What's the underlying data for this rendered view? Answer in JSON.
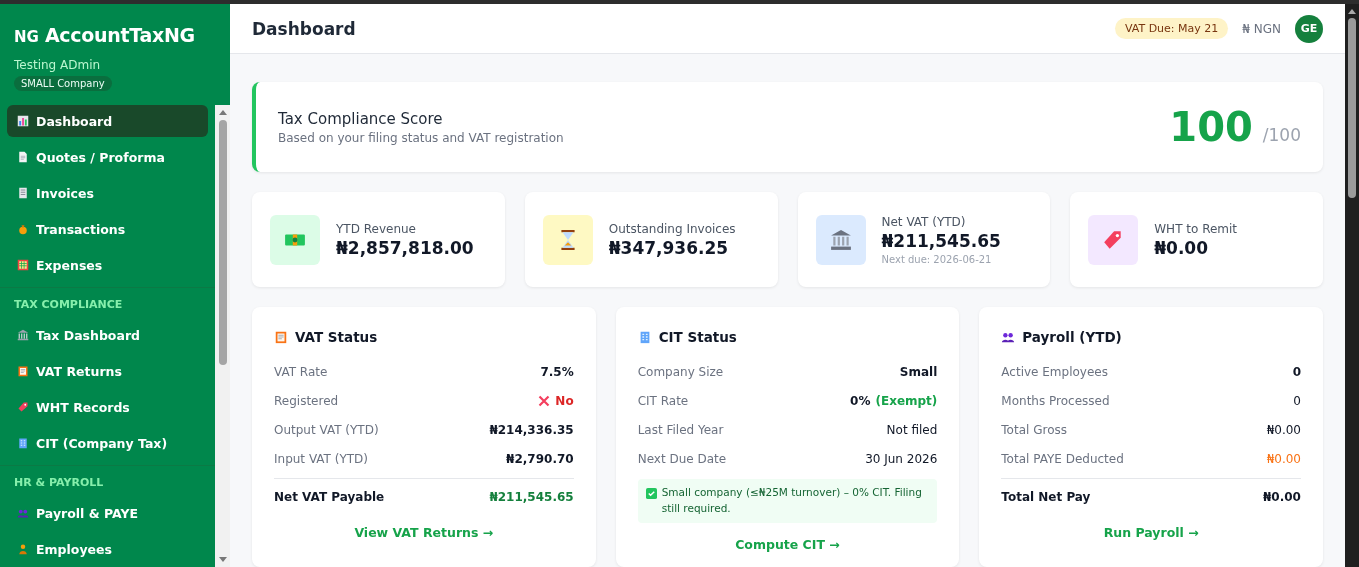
{
  "sidebar": {
    "logo_mark": "NG",
    "brand": "AccountTaxNG",
    "user": "Testing ADmin",
    "company_badge": "SMALL Company",
    "sections": [
      {
        "items": [
          {
            "label": "Dashboard",
            "selected": true
          },
          {
            "label": "Quotes / Proforma",
            "selected": false
          },
          {
            "label": "Invoices",
            "selected": false
          },
          {
            "label": "Transactions",
            "selected": false
          },
          {
            "label": "Expenses",
            "selected": false
          }
        ]
      },
      {
        "title": "TAX COMPLIANCE",
        "items": [
          {
            "label": "Tax Dashboard",
            "selected": false
          },
          {
            "label": "VAT Returns",
            "selected": false
          },
          {
            "label": "WHT Records",
            "selected": false
          },
          {
            "label": "CIT (Company Tax)",
            "selected": false
          }
        ]
      },
      {
        "title": "HR & PAYROLL",
        "items": [
          {
            "label": "Payroll & PAYE",
            "selected": false
          },
          {
            "label": "Employees",
            "selected": false
          }
        ]
      }
    ]
  },
  "header": {
    "title": "Dashboard",
    "vat_due_badge": "VAT Due: May 21",
    "currency": "₦ NGN",
    "avatar": "GE"
  },
  "compliance": {
    "title": "Tax Compliance Score",
    "subtitle": "Based on your filing status and VAT registration",
    "score": "100",
    "max": "/100"
  },
  "stats": [
    {
      "label": "YTD Revenue",
      "value": "₦2,857,818.00"
    },
    {
      "label": "Outstanding Invoices",
      "value": "₦347,936.25"
    },
    {
      "label": "Net VAT (YTD)",
      "value": "₦211,545.65",
      "note": "Next due: 2026-06-21"
    },
    {
      "label": "WHT to Remit",
      "value": "₦0.00"
    }
  ],
  "panels": [
    {
      "title": "VAT Status",
      "rows": [
        {
          "label": "VAT Rate",
          "value": "7.5%",
          "kind": "plain"
        },
        {
          "label": "Registered",
          "value": "No",
          "kind": "negative"
        },
        {
          "label": "Output VAT (YTD)",
          "value": "₦214,336.35",
          "kind": "plain"
        },
        {
          "label": "Input VAT (YTD)",
          "value": "₦2,790.70",
          "kind": "plain"
        },
        {
          "label": "Net VAT Payable",
          "value": "₦211,545.65",
          "kind": "positivetotal"
        }
      ],
      "link": "View VAT Returns →"
    },
    {
      "title": "CIT Status",
      "rows": [
        {
          "label": "Company Size",
          "value": "Small",
          "kind": "plain"
        },
        {
          "label": "CIT Rate",
          "value": "0%",
          "extra": "(Exempt)",
          "kind": "plain"
        },
        {
          "label": "Last Filed Year",
          "value": "Not filed",
          "kind": "light"
        },
        {
          "label": "Next Due Date",
          "value": "30 Jun 2026",
          "kind": "light"
        }
      ],
      "notice": "Small company (≤₦25M turnover) – 0% CIT. Filing still required.",
      "link": "Compute CIT →"
    },
    {
      "title": "Payroll (YTD)",
      "rows": [
        {
          "label": "Active Employees",
          "value": "0",
          "kind": "plain"
        },
        {
          "label": "Months Processed",
          "value": "0",
          "kind": "light"
        },
        {
          "label": "Total Gross",
          "value": "₦0.00",
          "kind": "light"
        },
        {
          "label": "Total PAYE Deducted",
          "value": "₦0.00",
          "kind": "warning"
        },
        {
          "label": "Total Net Pay",
          "value": "₦0.00",
          "kind": "total"
        }
      ],
      "link": "Run Payroll →"
    }
  ]
}
